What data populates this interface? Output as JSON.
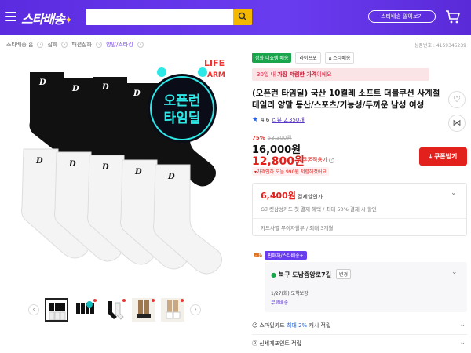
{
  "header": {
    "logo_text": "스타배송",
    "search_placeholder": "",
    "star_delivery_button": "스타배송 알아보기"
  },
  "breadcrumb": {
    "items": [
      "스타배송 홈",
      "잡화",
      "패션잡화",
      "양말/스타킹"
    ],
    "product_no": "상품번호 : 4159345239"
  },
  "gallery": {
    "image_text": {
      "life": "LIFE",
      "arm": "ARM",
      "badge_line1": "오픈런",
      "badge_line2": "타임딜"
    },
    "thumbnail_count": 5
  },
  "product": {
    "tags": [
      "정화 디쇼템 배송",
      "라이프포",
      "스타배송"
    ],
    "promo_text": "30일 내 ",
    "promo_bold": "가장 저렴한 가격",
    "promo_tail": "이에요",
    "title": "(오픈런 타임딜) 국산 10켤레 소프트 더블쿠션 사계절 데일리 양말 등산/스포츠/기능성/두꺼운 남성 여성",
    "rating": "4.6",
    "review_count": "리뷰 2,350개",
    "discount_pct": "75%",
    "original_price": "53,300원",
    "sale_price": "16,000원",
    "coupon_price": "12,800원",
    "coupon_label": "쿠폰적용가",
    "note": "가격인하 오늘 990원 저렴해졌어요",
    "coupon_button": "쿠폰받기"
  },
  "card_benefit": {
    "price": "6,400원",
    "label": "결제할인가",
    "sub": "G마켓삼성카드 첫 결제 혜택 / 최대 50% 결제 시 할인",
    "installment": "카드사별 무이자할부 / 최대 3개월"
  },
  "shipping": {
    "badge": "판매자/스타배송+",
    "location": "북구 도남중앙로7길",
    "change": "변경",
    "date": "1/27(화) 도착보장",
    "free": "무료배송"
  },
  "benefits": {
    "smile_prefix": "스마일카드 ",
    "smile_highlight": "최대 2%",
    "smile_suffix": " 캐시 적립",
    "point": "신세계포인트 적립"
  }
}
